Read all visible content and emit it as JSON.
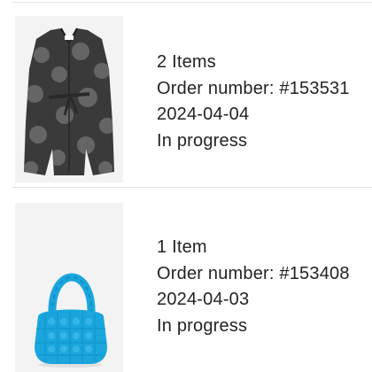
{
  "orders": [
    {
      "product_image": "wool-coat-polka-dot",
      "items": "2 Items",
      "order_number": "Order number: #153531",
      "date": "2024-04-04",
      "status": "In progress"
    },
    {
      "product_image": "blue-quilted-bag",
      "items": "1 Item",
      "order_number": "Order number: #153408",
      "date": "2024-04-03",
      "status": "In progress"
    }
  ],
  "colors": {
    "divider": "#e2e2e2",
    "text": "#232323",
    "thumb_bg": "#f3f3f3",
    "coat": "#3a3a3a",
    "coat_dots": "#6e6e6e",
    "bag": "#1aa6dd"
  }
}
